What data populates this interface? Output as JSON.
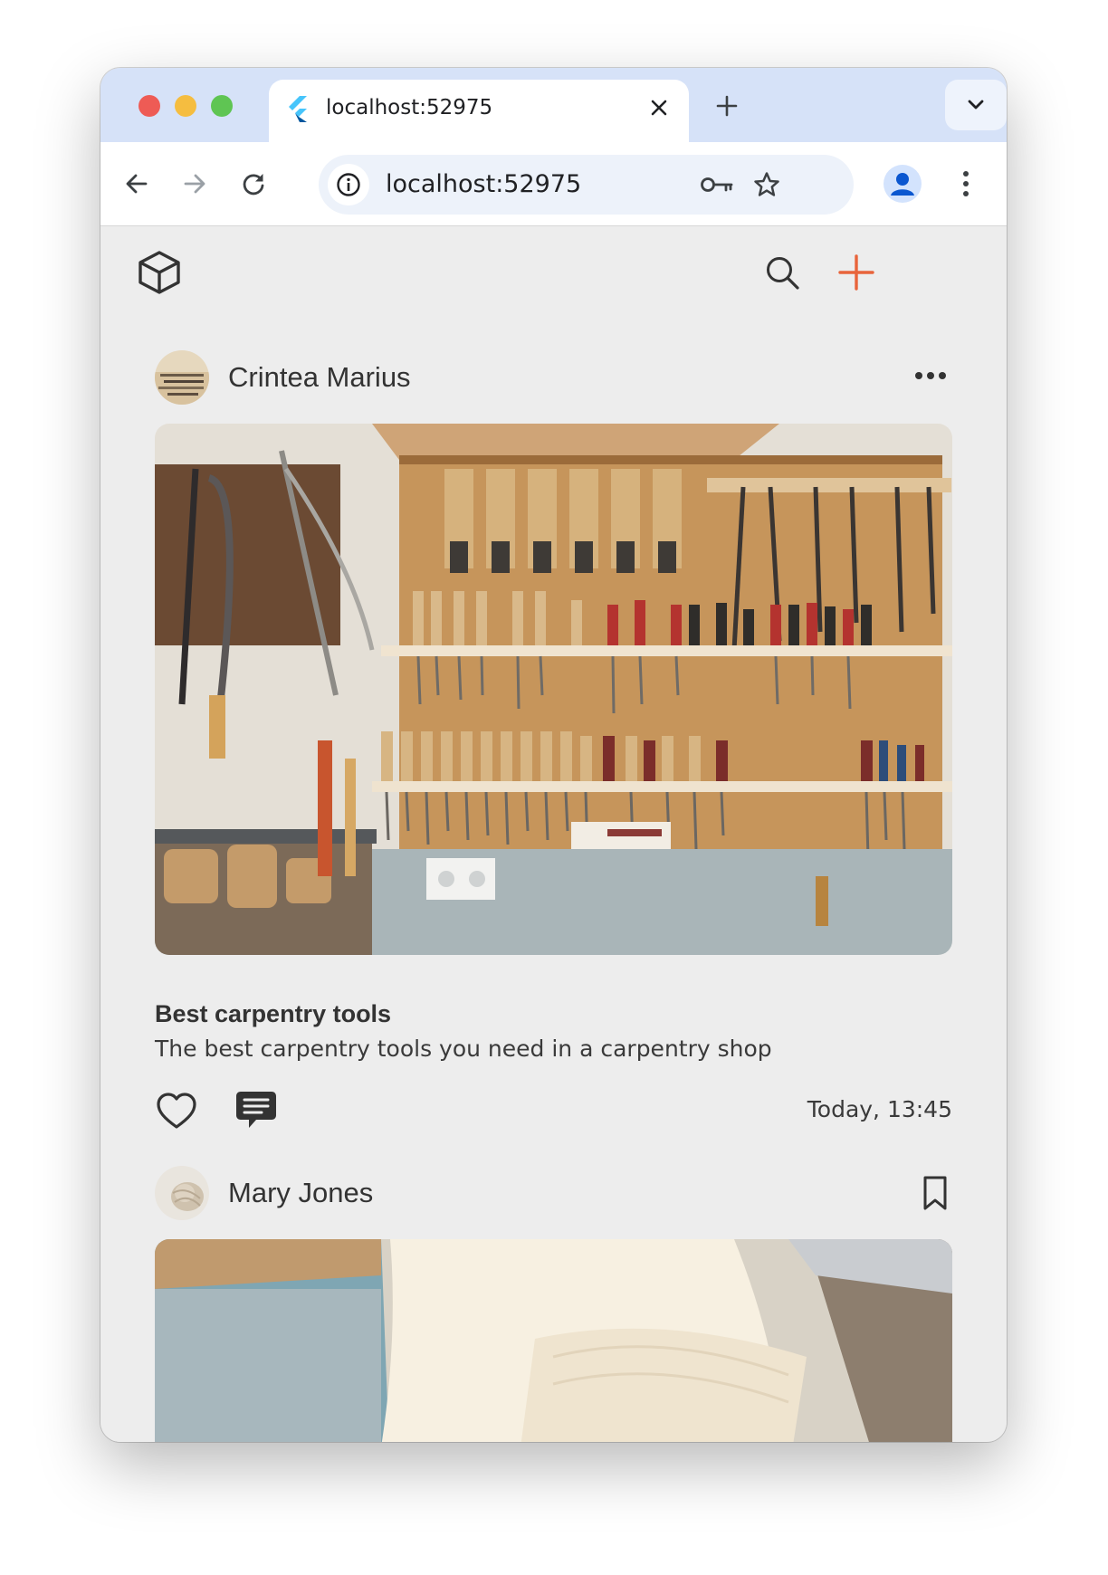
{
  "browser": {
    "tab_title": "localhost:52975",
    "url": "localhost:52975",
    "icons": {
      "back": "arrow-left-icon",
      "forward": "arrow-right-icon",
      "reload": "reload-icon",
      "site_info": "info-icon",
      "password": "key-icon",
      "bookmark": "star-icon",
      "profile": "person-icon",
      "menu": "kebab-icon",
      "close_tab": "close-icon",
      "new_tab": "plus-icon",
      "tab_search": "chevron-down-icon"
    },
    "traffic_colors": [
      "#ee5b55",
      "#f5bd40",
      "#5fc553"
    ]
  },
  "app": {
    "logo_icon": "cube-icon",
    "search_icon": "search-icon",
    "add_icon": "plus-icon",
    "accent_color": "#e8643b"
  },
  "posts": [
    {
      "author": "Crintea Marius",
      "title": "Best carpentry tools",
      "description": "The best carpentry tools you need in a carpentry shop",
      "timestamp": "Today, 13:45",
      "action_icon": "more-horizontal-icon",
      "like_icon": "heart-icon",
      "comment_icon": "comment-icon"
    },
    {
      "author": "Mary Jones",
      "action_icon": "bookmark-icon"
    }
  ]
}
